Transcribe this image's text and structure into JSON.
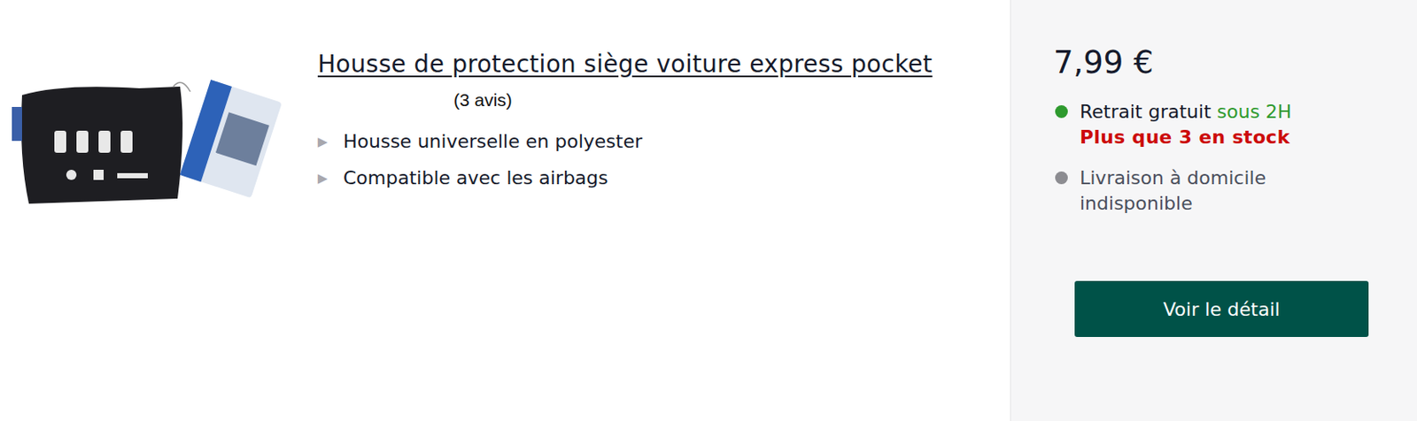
{
  "product": {
    "title": "Housse de protection siège voiture express pocket",
    "reviews": "(3 avis)",
    "features": [
      {
        "bullet": "▶",
        "text": "Housse universelle en polyester"
      },
      {
        "bullet": "▶",
        "text": "Compatible avec les airbags"
      }
    ]
  },
  "offer": {
    "price": "7,99 €",
    "availability": [
      {
        "label": "Retrait gratuit",
        "highlight": "sous 2H",
        "note": "Plus que 3 en stock",
        "color": "#2e9a2e",
        "available": true
      },
      {
        "label": "Livraison à domicile indisponible",
        "highlight": "",
        "note": "",
        "color": "#8c8c91",
        "available": false
      }
    ],
    "button": "Voir le détail"
  }
}
